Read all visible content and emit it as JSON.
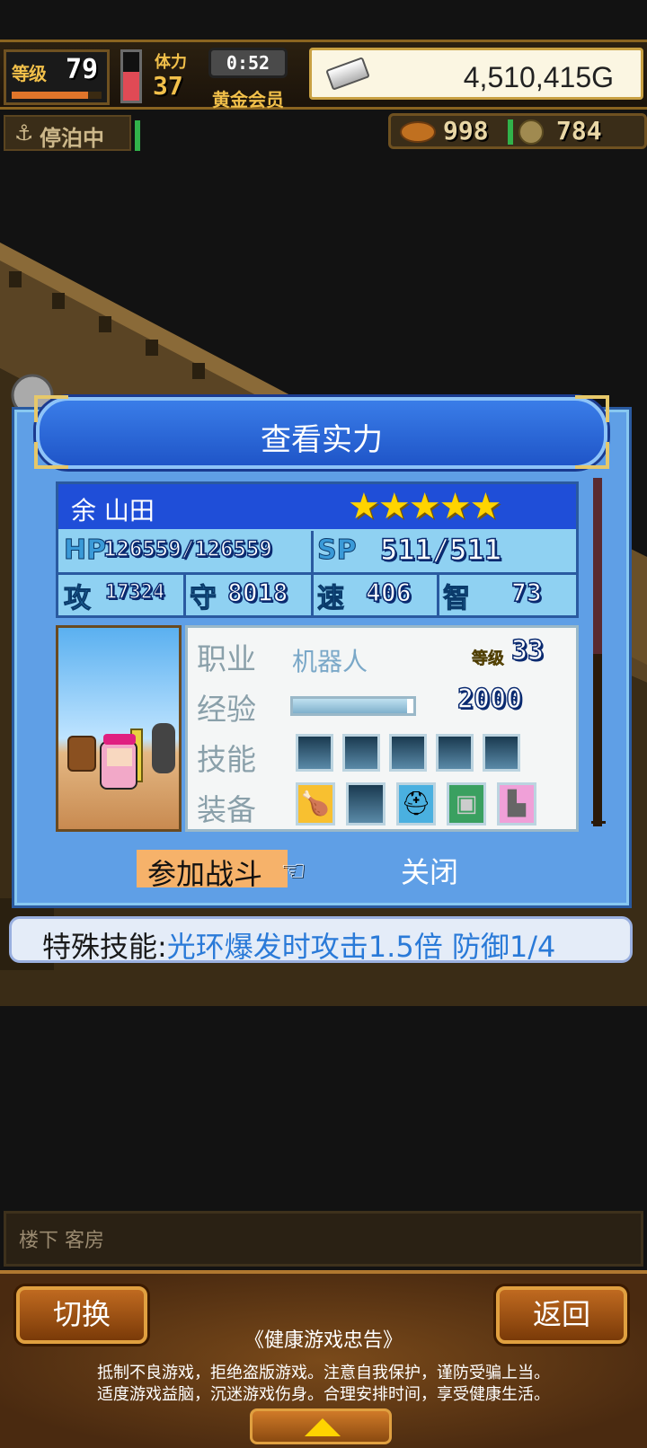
{
  "hud": {
    "level_label": "等级",
    "level": "79",
    "level_progress": 0.85,
    "stamina_label": "体力",
    "stamina": "37",
    "stamina_fill": 0.6,
    "timer": "0:52",
    "vip_label": "黄金会员",
    "gold": "4,510,415G",
    "dock_icon": "anchor-icon",
    "dock_status": "停泊中",
    "resource1_icon": "food-icon",
    "resource1": "998",
    "resource2_icon": "coin-icon",
    "resource2": "784"
  },
  "dialog": {
    "title": "查看实力",
    "name": "余 山田",
    "stars": "★★★★★",
    "star_count": 5,
    "stats": {
      "hp_label": "HP",
      "hp": "126559/126559",
      "sp_label": "SP",
      "sp": "511/511",
      "atk_label": "攻",
      "atk": "17324",
      "def_label": "守",
      "def": "8018",
      "spd_label": "速",
      "spd": "406",
      "int_label": "智",
      "int": "73"
    },
    "info": {
      "job_label": "职业",
      "job": "机器人",
      "rank_label": "等级",
      "rank": "33",
      "exp_label": "经验",
      "exp": "2000",
      "exp_progress": 0.95,
      "skill_label": "技能",
      "equip_label": "装备"
    },
    "equipment_icons": [
      "club-icon",
      "empty-slot-icon",
      "helmet-icon",
      "armor-icon",
      "boots-icon"
    ],
    "join_button": "参加战斗",
    "hand_icon": "pointing-hand-icon",
    "close_button": "关闭"
  },
  "special": {
    "label": "特殊技能:",
    "value": "光环爆发时攻击1.5倍 防御1/4"
  },
  "bottom": {
    "room": "楼下 客房",
    "switch_button": "切换",
    "back_button": "返回",
    "notice_title": "《健康游戏忠告》",
    "notice_line1": "抵制不良游戏，拒绝盗版游戏。注意自我保护，谨防受骗上当。",
    "notice_line2": "适度游戏益脑，沉迷游戏伤身。合理安排时间，享受健康生活。",
    "up_icon": "up-arrow-icon"
  }
}
